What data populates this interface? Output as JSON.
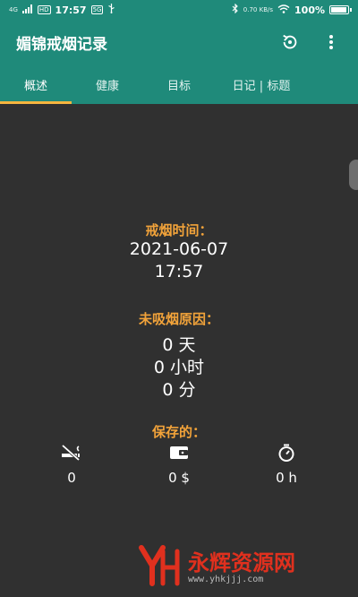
{
  "status_bar": {
    "signal_label": "4G",
    "hd_label": "HD",
    "time": "17:57",
    "badge": "5G",
    "net_speed": "0.70 KB/s",
    "battery": "100%",
    "battery_level": 1.0
  },
  "app_bar": {
    "title": "媚锦戒烟记录",
    "reset_icon": "reset-icon",
    "menu_icon": "more-vert-icon"
  },
  "tabs": [
    {
      "label": "概述",
      "active": true
    },
    {
      "label": "健康",
      "active": false
    },
    {
      "label": "目标",
      "active": false
    },
    {
      "label": "日记 | 标题",
      "active": false
    }
  ],
  "quit_time": {
    "label": "戒烟时间：",
    "date": "2021-06-07",
    "time": "17:57"
  },
  "not_smoked": {
    "label": "未吸烟原因：",
    "days": "0 天",
    "hours": "0 小时",
    "minutes": "0 分"
  },
  "saved": {
    "label": "保存的：",
    "items": [
      {
        "icon": "no-smoking-icon",
        "value": "0"
      },
      {
        "icon": "wallet-icon",
        "value": "0 $"
      },
      {
        "icon": "stopwatch-icon",
        "value": "0 h"
      }
    ]
  },
  "watermark": {
    "text": "永辉资源网",
    "url": "www.yhkjjj.com"
  },
  "colors": {
    "primary": "#1f8a7a",
    "accent": "#f5b53f",
    "label": "#f2a33a",
    "background": "#303030"
  }
}
